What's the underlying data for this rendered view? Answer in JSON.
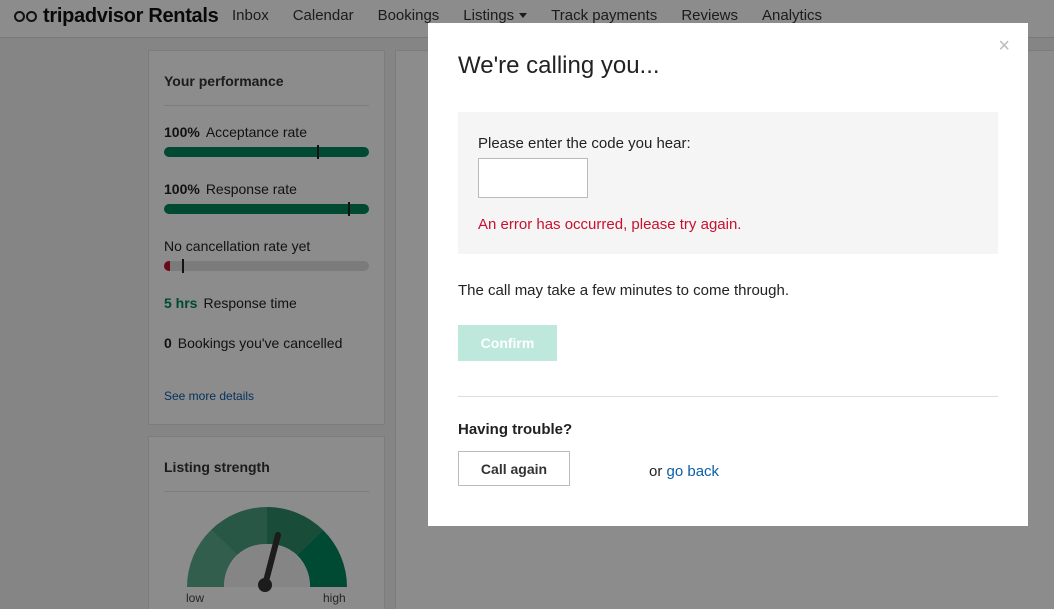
{
  "header": {
    "brand": "tripadvisor Rentals",
    "nav": [
      {
        "label": "Inbox"
      },
      {
        "label": "Calendar"
      },
      {
        "label": "Bookings"
      },
      {
        "label": "Listings",
        "has_caret": true
      },
      {
        "label": "Track payments"
      },
      {
        "label": "Reviews"
      },
      {
        "label": "Analytics"
      }
    ]
  },
  "performance": {
    "title": "Your performance",
    "acceptance": {
      "value": "100%",
      "label": "Acceptance rate",
      "fill": 1.0
    },
    "response": {
      "value": "100%",
      "label": "Response rate",
      "fill": 1.0
    },
    "cancellation": {
      "label": "No cancellation rate yet",
      "fill": 0.0
    },
    "response_time": {
      "value": "5 hrs",
      "label": "Response time"
    },
    "cancelled": {
      "value": "0",
      "label": "Bookings you've cancelled"
    },
    "link": "See more details"
  },
  "listing_strength": {
    "title": "Listing strength",
    "low": "low",
    "high": "high"
  },
  "modal": {
    "title": "We're calling you...",
    "code_label": "Please enter the code you hear:",
    "code_value": "",
    "error": "An error has occurred, please try again.",
    "note": "The call may take a few minutes to come through.",
    "confirm": "Confirm",
    "trouble": "Having trouble?",
    "call_again": "Call again",
    "or": "or",
    "go_back": "go back",
    "close": "×"
  },
  "colors": {
    "accent_green": "#00865c",
    "error_red": "#c8102e",
    "link_blue": "#0a5ea8",
    "confirm_disabled": "#bde8db"
  }
}
